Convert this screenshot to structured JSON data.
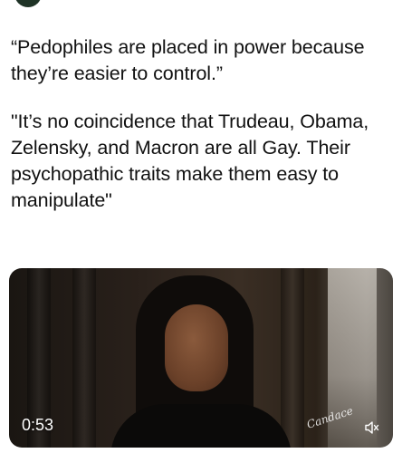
{
  "post": {
    "quote_1": "“Pedophiles are placed in power because they’re easier to control.”",
    "quote_2": "\"It’s no coincidence that Trudeau, Obama, Zelensky, and Macron are all Gay. Their psychopathic traits make them easy to manipulate\""
  },
  "video": {
    "duration": "0:53",
    "watermark": "Candace",
    "mute_icon": "speaker-muted-icon"
  }
}
